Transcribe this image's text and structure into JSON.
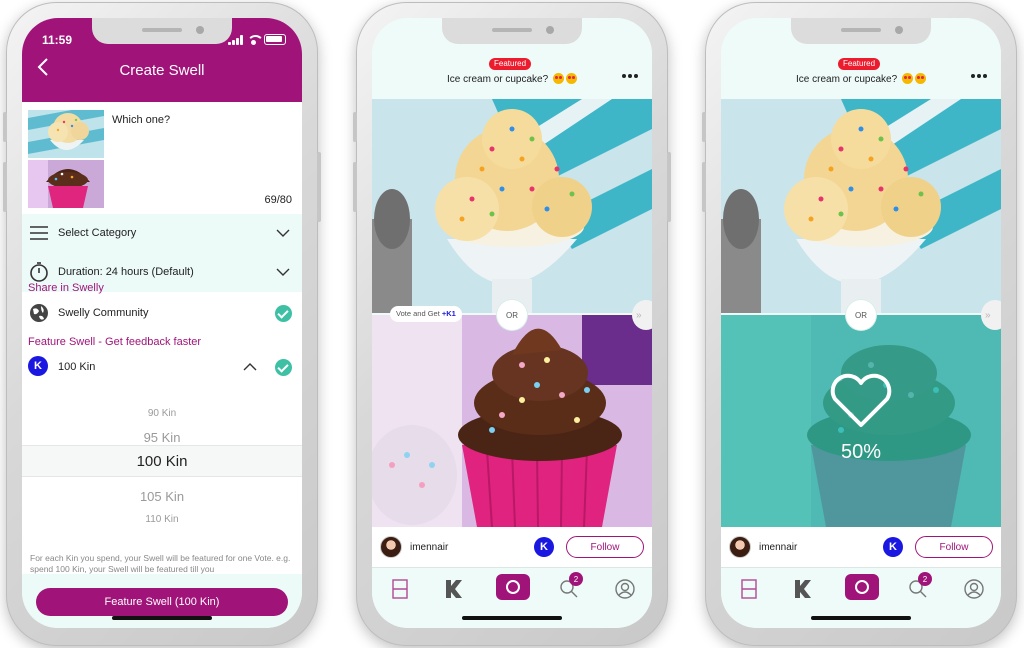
{
  "create_screen": {
    "status_time": "11:59",
    "title": "Create Swell",
    "question": "Which one?",
    "char_count": "69/80",
    "category_label": "Select Category",
    "duration_label": "Duration: 24 hours (Default)",
    "share_section": "Share in Swelly",
    "community_label": "Swelly Community",
    "feature_section": "Feature Swell - Get feedback faster",
    "kin_amount": "100 Kin",
    "kin_icon_glyph": "K",
    "picker_options": [
      "90 Kin",
      "95 Kin",
      "100 Kin",
      "105 Kin",
      "110 Kin"
    ],
    "note": "For each Kin you spend, your Swell will be featured for one Vote. e.g. spend 100 Kin, your Swell will be featured till you",
    "cta_label": "Feature Swell (100 Kin)"
  },
  "vote_screen": {
    "badge": "Featured",
    "title": "Ice cream or cupcake?",
    "vote_pill_text": "Vote and Get",
    "vote_pill_reward": "+K1",
    "or_label": "OR",
    "next_arrow": "»",
    "username": "imennair",
    "kin_glyph": "K",
    "follow_label": "Follow",
    "notification_count": "2"
  },
  "result_screen": {
    "badge": "Featured",
    "title": "Ice cream or cupcake?",
    "or_label": "OR",
    "next_arrow": "»",
    "result_percent": "50%",
    "username": "imennair",
    "kin_glyph": "K",
    "follow_label": "Follow",
    "notification_count": "2"
  },
  "colors": {
    "brand": "#a0147a",
    "kin_blue": "#1a17e0",
    "accent_teal": "#3ec0a5",
    "featured_red": "#ec1c2e"
  }
}
